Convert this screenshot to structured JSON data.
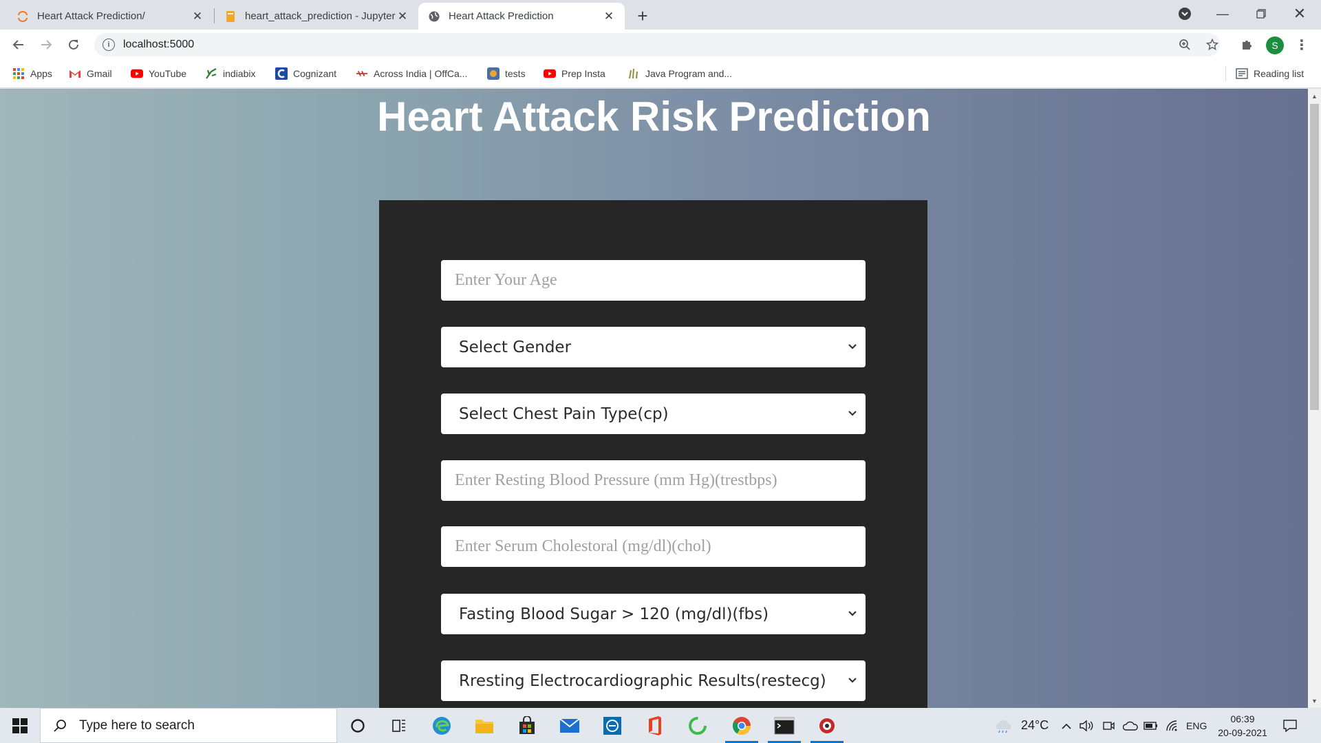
{
  "browser": {
    "tabs": [
      {
        "title": "Heart Attack Prediction/",
        "favicon": "jupyter-spinner-icon",
        "active": false
      },
      {
        "title": "heart_attack_prediction - Jupyter",
        "favicon": "notebook-icon",
        "active": false
      },
      {
        "title": "Heart Attack Prediction",
        "favicon": "globe-icon",
        "active": true
      }
    ],
    "url": "localhost:5000",
    "profile_initial": "S",
    "bookmarks": [
      {
        "label": "Apps",
        "icon": "apps-grid-icon"
      },
      {
        "label": "Gmail",
        "icon": "gmail-icon"
      },
      {
        "label": "YouTube",
        "icon": "youtube-icon"
      },
      {
        "label": "indiabix",
        "icon": "indiabix-icon"
      },
      {
        "label": "Cognizant",
        "icon": "cognizant-icon"
      },
      {
        "label": "Across India | OffCa...",
        "icon": "offcampus-icon"
      },
      {
        "label": "tests",
        "icon": "tests-icon"
      },
      {
        "label": "Prep Insta",
        "icon": "youtube-icon"
      },
      {
        "label": "Java Program and...",
        "icon": "java-icon"
      }
    ],
    "reading_list": "Reading list"
  },
  "page": {
    "title": "Heart Attack Risk Prediction",
    "fields": [
      {
        "type": "input",
        "placeholder": "Enter Your Age"
      },
      {
        "type": "select",
        "value": "Select Gender"
      },
      {
        "type": "select",
        "value": "Select Chest Pain Type(cp)"
      },
      {
        "type": "input",
        "placeholder": "Enter Resting Blood Pressure (mm Hg)(trestbps)"
      },
      {
        "type": "input",
        "placeholder": "Enter Serum Cholestoral (mg/dl)(chol)"
      },
      {
        "type": "select",
        "value": "Fasting Blood Sugar > 120 (mg/dl)(fbs)"
      },
      {
        "type": "select",
        "value": "Rresting Electrocardiographic Results(restecg)"
      }
    ]
  },
  "taskbar": {
    "search_placeholder": "Type here to search",
    "temperature": "24°C",
    "language": "ENG",
    "time": "06:39",
    "date": "20-09-2021"
  }
}
